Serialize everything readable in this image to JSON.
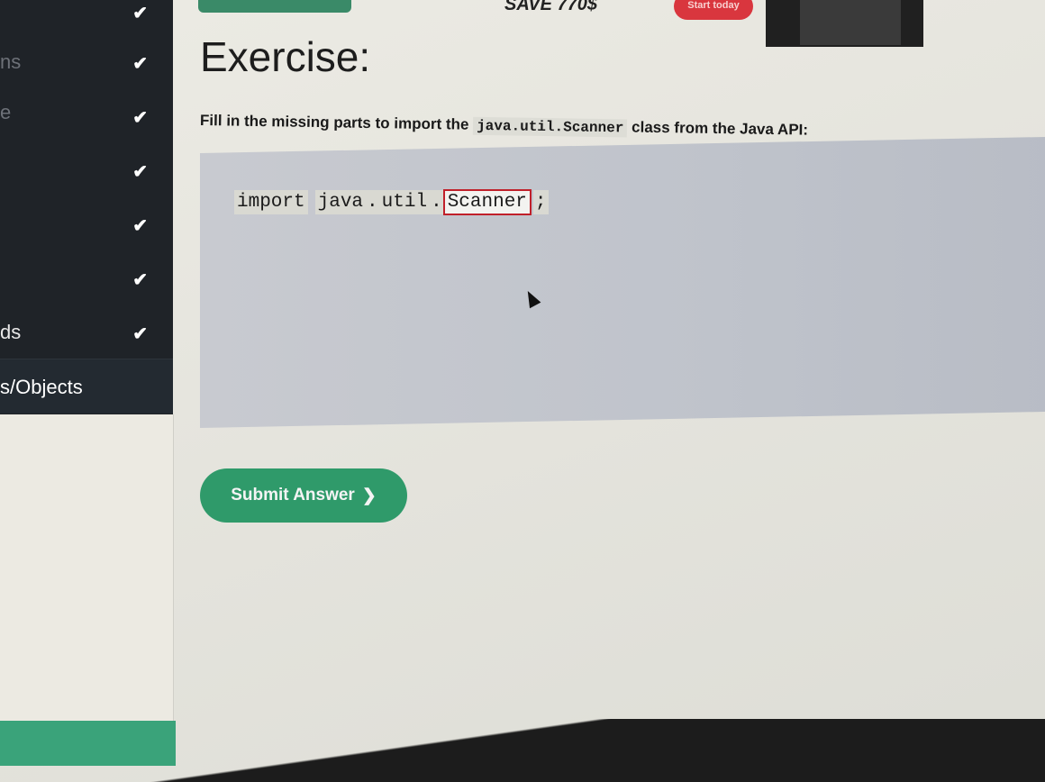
{
  "banner": {
    "promo_text": "SAVE 770$",
    "start_label": "Start today"
  },
  "sidebar": {
    "items": [
      {
        "label": "ns",
        "checked": true
      },
      {
        "label": "e",
        "checked": true
      },
      {
        "label": "",
        "checked": true
      },
      {
        "label": "",
        "checked": true
      },
      {
        "label": "",
        "checked": true
      },
      {
        "label": "ds",
        "checked": true
      },
      {
        "label": "s/Objects",
        "checked": false
      }
    ],
    "check_glyph": "✔"
  },
  "exercise": {
    "title": "Exercise:",
    "instruction_prefix": "Fill in the missing parts to import the",
    "instruction_code": "java.util.Scanner",
    "instruction_suffix": "class from the Java API:",
    "code": {
      "keyword": "import",
      "pkg1": "java",
      "dot1": ".",
      "pkg2": "util",
      "dot2": ".",
      "answer": "Scanner",
      "semicolon": ";"
    },
    "submit_label": "Submit Answer",
    "submit_icon": "❯"
  },
  "colors": {
    "accent": "#2f9a6a",
    "sidebar_bg": "#1f2328",
    "error_border": "#c0202a",
    "promo_button": "#d9363e"
  }
}
